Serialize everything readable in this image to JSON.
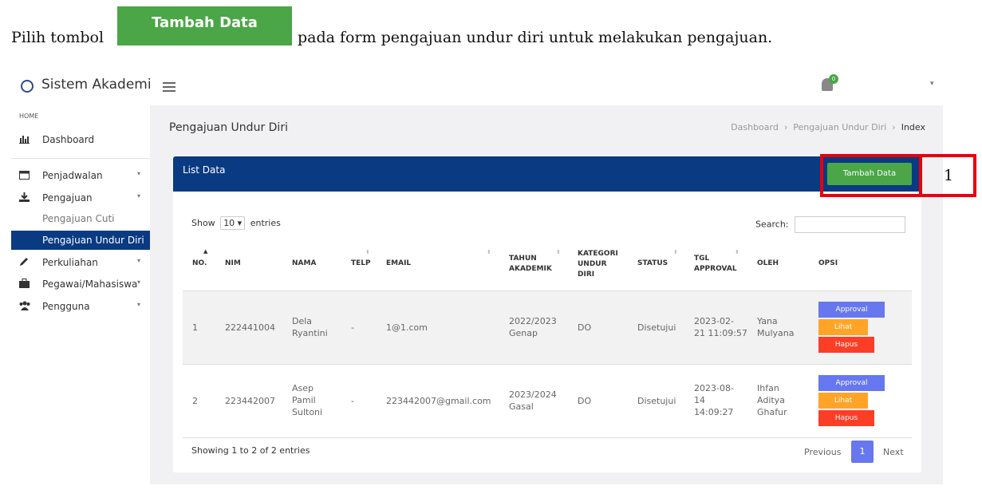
{
  "doc": {
    "prefix": "Pilih tombol",
    "button": "Tambah Data",
    "suffix": "pada form pengajuan undur diri untuk melakukan pengajuan.",
    "callout_number": "1"
  },
  "topbar": {
    "brand": "Sistem Akademik",
    "notif_count": "0",
    "caret": "▾"
  },
  "sidebar": {
    "home_label": "HOME",
    "items": [
      {
        "label": "Dashboard",
        "icon": "bar-chart-icon"
      },
      {
        "label": "Penjadwalan",
        "icon": "calendar-icon"
      },
      {
        "label": "Pengajuan",
        "icon": "download-icon"
      },
      {
        "label": "Pengajuan Cuti"
      },
      {
        "label": "Pengajuan Undur Diri"
      },
      {
        "label": "Perkuliahan",
        "icon": "pencil-icon"
      },
      {
        "label": "Pegawai/Mahasiswa",
        "icon": "briefcase-icon"
      },
      {
        "label": "Pengguna",
        "icon": "users-icon"
      }
    ],
    "caret": "▾"
  },
  "header": {
    "title": "Pengajuan Undur Diri",
    "breadcrumb": [
      "Dashboard",
      "Pengajuan Undur Diri",
      "Index"
    ],
    "sep": "›"
  },
  "card": {
    "title": "List Data",
    "add_button": "Tambah Data",
    "show_label": "Show",
    "show_value": "10",
    "entries_label": "entries",
    "search_label": "Search:",
    "columns": [
      "NO.",
      "NIM",
      "NAMA",
      "TELP",
      "EMAIL",
      "TAHUN\nAKADEMIK",
      "KATEGORI\nUNDUR\nDIRI",
      "STATUS",
      "TGL\nAPPROVAL",
      "OLEH",
      "OPSI"
    ],
    "rows": [
      {
        "no": "1",
        "nim": "222441004",
        "nama": "Dela\nRyantini",
        "telp": "-",
        "email": "1@1.com",
        "tahun": "2022/2023\nGenap",
        "kategori": "DO",
        "status": "Disetujui",
        "tgl": "2023-02-\n21 11:09:57",
        "oleh": "Yana\nMulyana"
      },
      {
        "no": "2",
        "nim": "223442007",
        "nama": "Asep\nPamil\nSultoni",
        "telp": "-",
        "email": "223442007@gmail.com",
        "tahun": "2023/2024\nGasal",
        "kategori": "DO",
        "status": "Disetujui",
        "tgl": "2023-08-\n14\n14:09:27",
        "oleh": "Ihfan\nAditya\nGhafur"
      }
    ],
    "actions": {
      "approval": "Approval",
      "lihat": "Lihat",
      "hapus": "Hapus"
    },
    "showing": "Showing 1 to 2 of 2 entries",
    "prev": "Previous",
    "page": "1",
    "next": "Next"
  },
  "colors": {
    "brand_blue": "#0a3a82",
    "green": "#4aa646",
    "highlight_red": "#e8000b"
  }
}
